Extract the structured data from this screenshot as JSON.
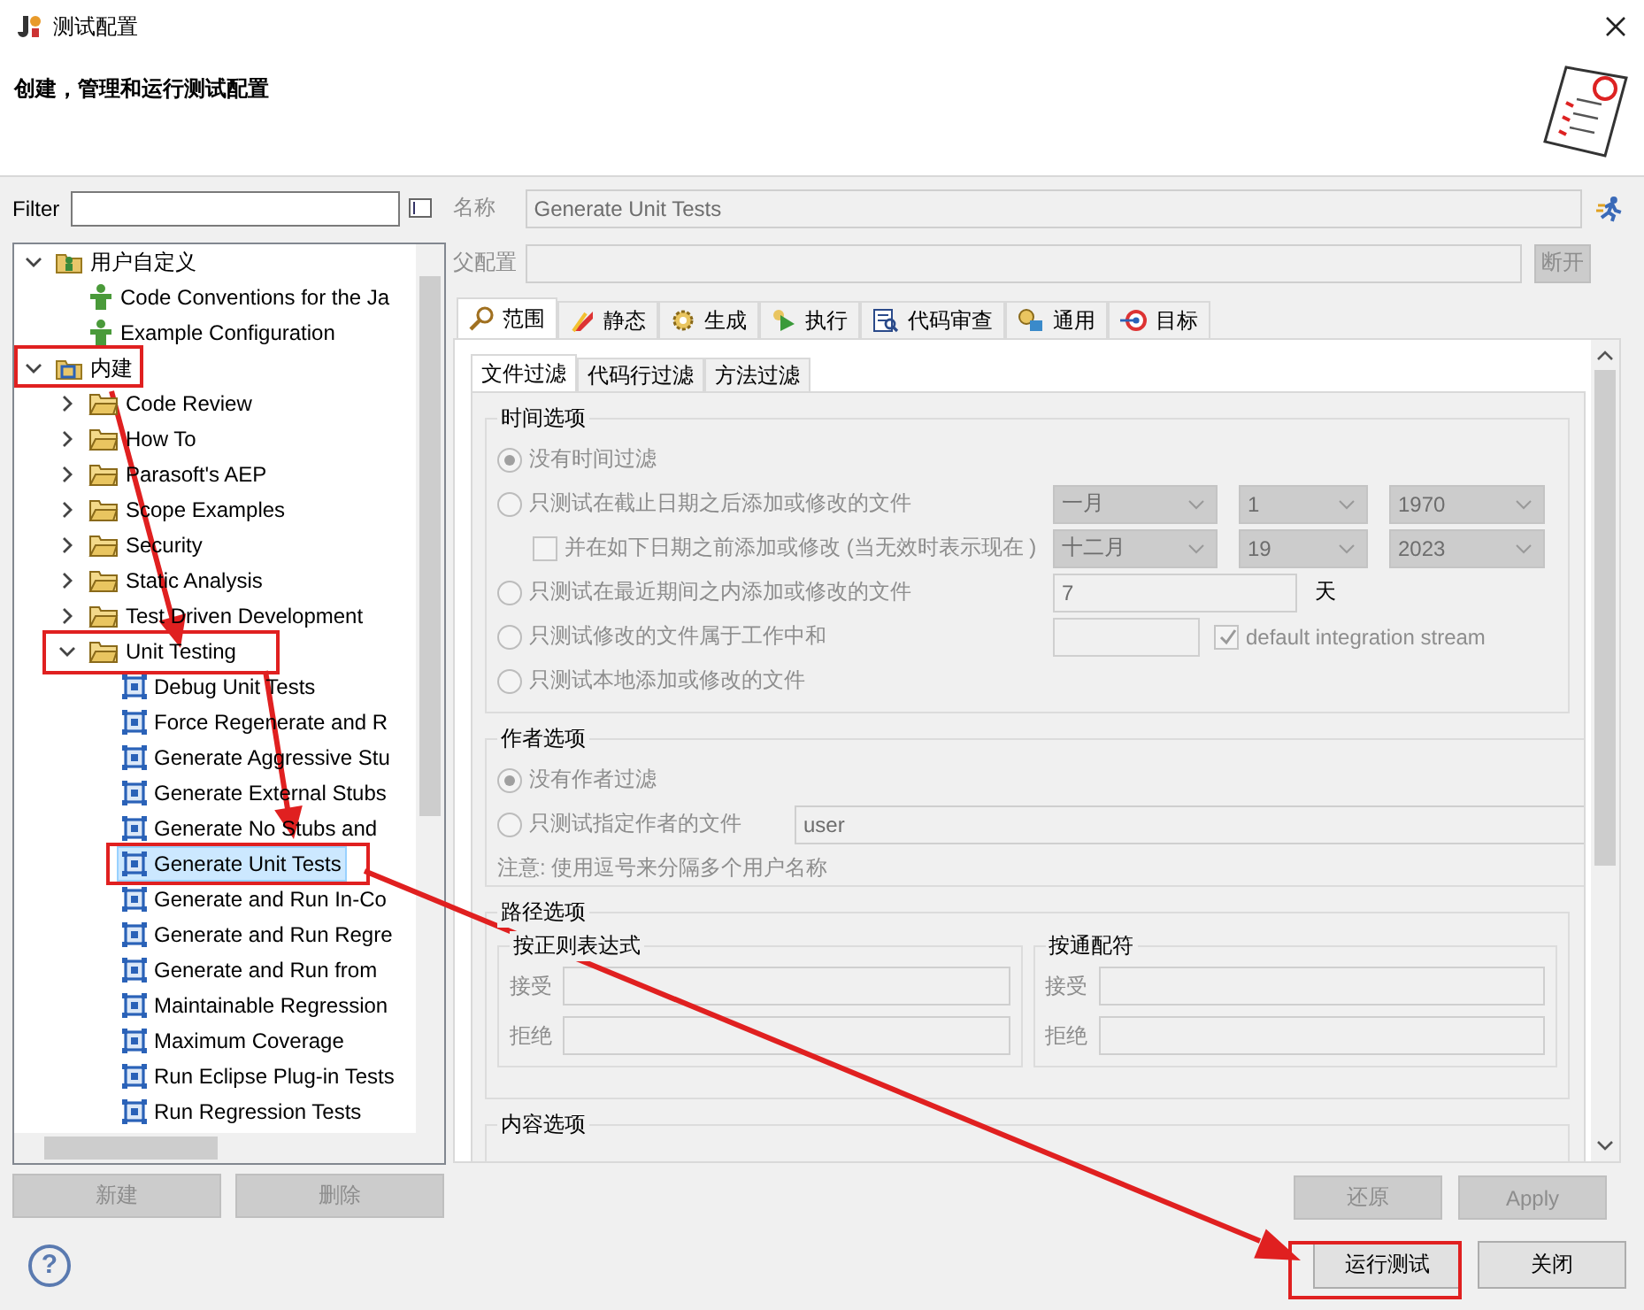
{
  "window": {
    "title": "测试配置"
  },
  "header": {
    "text": "创建，管理和运行测试配置"
  },
  "filter": {
    "label": "Filter"
  },
  "tree": [
    {
      "label": "用户自定义",
      "kind": "custom-root",
      "expanded": true,
      "selected": false,
      "children": [
        {
          "label": "Code Conventions for the Ja",
          "kind": "user-config",
          "selected": false
        },
        {
          "label": "Example Configuration",
          "kind": "user-config",
          "selected": false
        }
      ]
    },
    {
      "label": "内建",
      "kind": "builtin-root",
      "expanded": true,
      "selected": false,
      "children": [
        {
          "label": "Code Review",
          "kind": "folder",
          "expanded": false,
          "selected": false
        },
        {
          "label": "How To",
          "kind": "folder",
          "expanded": false,
          "selected": false
        },
        {
          "label": "Parasoft's AEP",
          "kind": "folder",
          "expanded": false,
          "selected": false
        },
        {
          "label": "Scope Examples",
          "kind": "folder",
          "expanded": false,
          "selected": false
        },
        {
          "label": "Security",
          "kind": "folder",
          "expanded": false,
          "selected": false
        },
        {
          "label": "Static Analysis",
          "kind": "folder",
          "expanded": false,
          "selected": false
        },
        {
          "label": "Test Driven Development",
          "kind": "folder",
          "expanded": false,
          "selected": false
        },
        {
          "label": "Unit Testing",
          "kind": "folder",
          "expanded": true,
          "selected": false,
          "children": [
            {
              "label": "Debug Unit Tests",
              "kind": "test-config",
              "selected": false
            },
            {
              "label": "Force Regenerate and R",
              "kind": "test-config",
              "selected": false
            },
            {
              "label": "Generate Aggressive Stu",
              "kind": "test-config",
              "selected": false
            },
            {
              "label": "Generate External Stubs",
              "kind": "test-config",
              "selected": false
            },
            {
              "label": "Generate No Stubs and",
              "kind": "test-config",
              "selected": false
            },
            {
              "label": "Generate Unit Tests",
              "kind": "test-config",
              "selected": true
            },
            {
              "label": "Generate and Run In-Co",
              "kind": "test-config",
              "selected": false
            },
            {
              "label": "Generate and Run Regre",
              "kind": "test-config",
              "selected": false
            },
            {
              "label": "Generate and Run from",
              "kind": "test-config",
              "selected": false
            },
            {
              "label": "Maintainable Regression",
              "kind": "test-config",
              "selected": false
            },
            {
              "label": "Maximum Coverage",
              "kind": "test-config",
              "selected": false
            },
            {
              "label": "Run Eclipse Plug-in Tests",
              "kind": "test-config",
              "selected": false
            },
            {
              "label": "Run Regression Tests",
              "kind": "test-config",
              "selected": false
            }
          ]
        }
      ]
    }
  ],
  "config": {
    "name_label": "名称",
    "name_value": "Generate Unit Tests",
    "parent_label": "父配置",
    "disconnect_button": "断开"
  },
  "tabs": [
    {
      "label": "范围",
      "kind": "scope",
      "selected": true
    },
    {
      "label": "静态",
      "kind": "static",
      "selected": false
    },
    {
      "label": "生成",
      "kind": "generate",
      "selected": false
    },
    {
      "label": "执行",
      "kind": "execute",
      "selected": false
    },
    {
      "label": "代码审查",
      "kind": "review",
      "selected": false
    },
    {
      "label": "通用",
      "kind": "common",
      "selected": false
    },
    {
      "label": "目标",
      "kind": "target",
      "selected": false
    }
  ],
  "subtabs": [
    {
      "label": "文件过滤",
      "selected": true
    },
    {
      "label": "代码行过滤",
      "selected": false
    },
    {
      "label": "方法过滤",
      "selected": false
    }
  ],
  "time_options": {
    "title": "时间选项",
    "disabled": true,
    "rows": [
      {
        "kind": "radio",
        "label": "没有时间过滤",
        "selected": true
      },
      {
        "kind": "radio-dates",
        "label": "只测试在截止日期之后添加或修改的文件",
        "selected": false,
        "dates": [
          "一月",
          "1",
          "1970"
        ]
      },
      {
        "kind": "check-dates",
        "label": "并在如下日期之前添加或修改 (当无效时表示现在 )",
        "checked": false,
        "dates": [
          "十二月",
          "19",
          "2023"
        ]
      },
      {
        "kind": "radio-days",
        "label": "只测试在最近期间之内添加或修改的文件",
        "selected": false,
        "value": "7",
        "unit": "天"
      },
      {
        "kind": "radio-stream",
        "label": "只测试修改的文件属于工作中和",
        "selected": false,
        "stream_label": "default integration stream",
        "stream_checked": true
      },
      {
        "kind": "radio",
        "label": "只测试本地添加或修改的文件",
        "selected": false
      }
    ]
  },
  "author_options": {
    "title": "作者选项",
    "disabled": true,
    "rows": [
      {
        "kind": "radio",
        "label": "没有作者过滤",
        "selected": true
      },
      {
        "kind": "radio-field",
        "label": "只测试指定作者的文件",
        "selected": false,
        "value": "user"
      }
    ],
    "note": "注意: 使用逗号来分隔多个用户名称"
  },
  "path_options": {
    "title": "路径选项",
    "groups": [
      {
        "title": "按正则表达式",
        "fields": [
          "接受",
          "拒绝"
        ]
      },
      {
        "title": "按通配符",
        "fields": [
          "接受",
          "拒绝"
        ]
      }
    ]
  },
  "content_options": {
    "title": "内容选项"
  },
  "left_buttons": [
    {
      "label": "新建",
      "disabled": true
    },
    {
      "label": "删除",
      "disabled": true
    }
  ],
  "right_buttons": [
    {
      "label": "还原",
      "disabled": true
    },
    {
      "label": "Apply",
      "disabled": true
    }
  ],
  "help": "?",
  "bottom_buttons": [
    {
      "label": "运行测试",
      "disabled": false
    },
    {
      "label": "关闭",
      "disabled": false
    }
  ]
}
